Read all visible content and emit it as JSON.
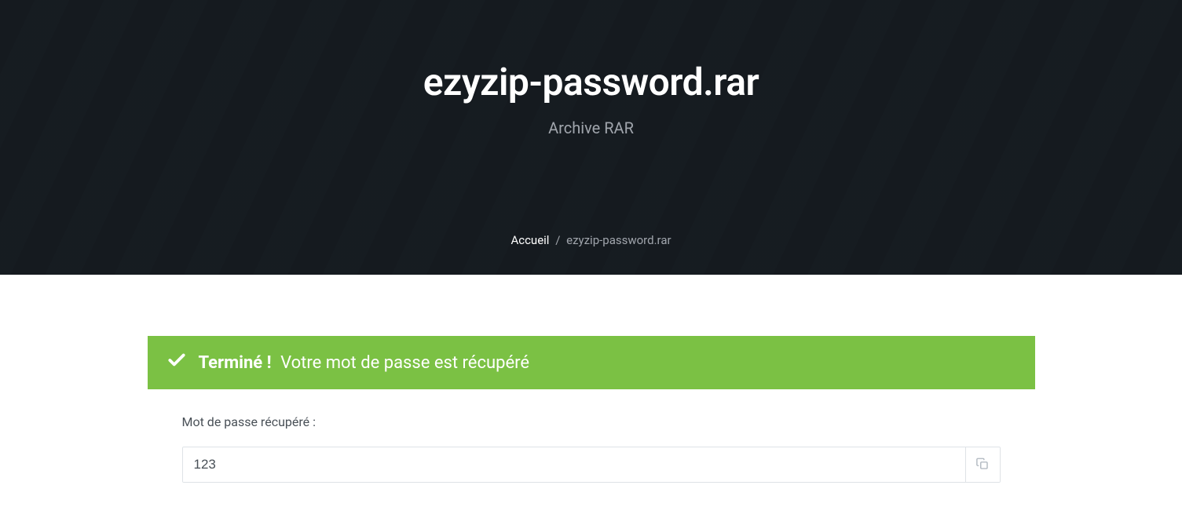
{
  "hero": {
    "title": "ezyzip-password.rar",
    "subtitle": "Archive RAR"
  },
  "breadcrumb": {
    "home": "Accueil",
    "separator": "/",
    "current": "ezyzip-password.rar"
  },
  "alert": {
    "bold": "Terminé !",
    "text": "Votre mot de passe est récupéré"
  },
  "result": {
    "label": "Mot de passe récupéré :",
    "password": "123"
  }
}
